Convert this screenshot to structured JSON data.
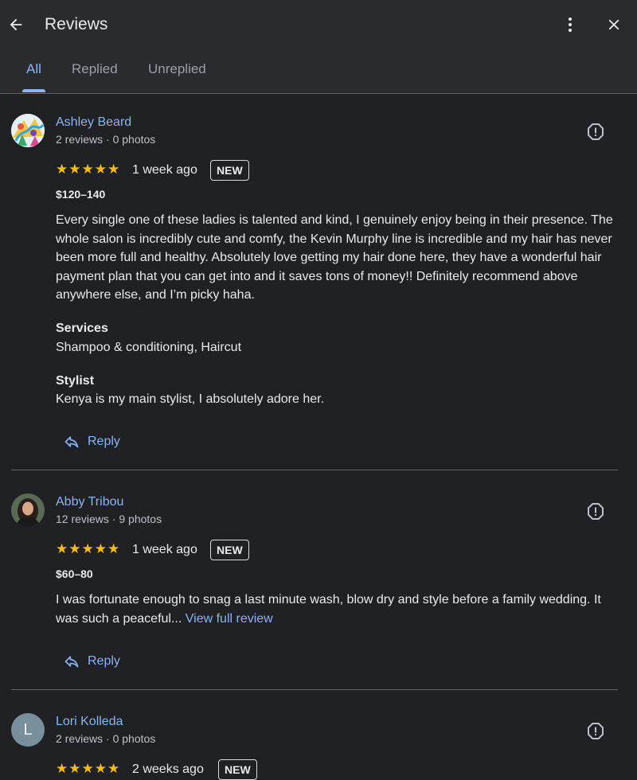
{
  "header": {
    "title": "Reviews",
    "back_icon": "arrow-left-icon",
    "more_icon": "more-vertical-icon",
    "close_icon": "close-icon"
  },
  "tabs": [
    {
      "label": "All",
      "active": true
    },
    {
      "label": "Replied",
      "active": false
    },
    {
      "label": "Unreplied",
      "active": false
    }
  ],
  "colors": {
    "background": "#202124",
    "header_bg": "#2a2b2f",
    "accent": "#8ab4f8",
    "star": "#fbbc04",
    "divider": "#5f6368"
  },
  "reviews": [
    {
      "author": "Ashley Beard",
      "meta": "2 reviews · 0 photos",
      "rating": 5,
      "stars": "★★★★★",
      "date": "1 week ago",
      "badge": "NEW",
      "price": "$120–140",
      "text": "Every single one of these ladies is talented and kind, I genuinely enjoy being in their presence. The whole salon is incredibly cute and comfy, the Kevin Murphy line is incredible and my hair has never been more full and healthy. Absolutely love getting my hair done here, they have a wonderful hair payment plan that you can get into and it saves tons of money!! Definitely recommend above anywhere else, and I’m picky haha.",
      "services_label": "Services",
      "services": "Shampoo & conditioning, Haircut",
      "stylist_label": "Stylist",
      "stylist": "Kenya is my main stylist, I absolutely adore her.",
      "reply_label": "Reply"
    },
    {
      "author": "Abby Tribou",
      "meta": "12 reviews · 9 photos",
      "rating": 5,
      "stars": "★★★★★",
      "date": "1 week ago",
      "badge": "NEW",
      "price": "$60–80",
      "text": "I was fortunate enough to snag a last minute wash, blow dry and style before a family wedding. It was such a peaceful...",
      "view_full": "View full review",
      "reply_label": "Reply"
    },
    {
      "author": "Lori Kolleda",
      "avatar_letter": "L",
      "meta": "2 reviews · 0 photos",
      "rating": 5,
      "stars": "★★★★★",
      "date": "2 weeks ago",
      "badge": "NEW"
    }
  ]
}
